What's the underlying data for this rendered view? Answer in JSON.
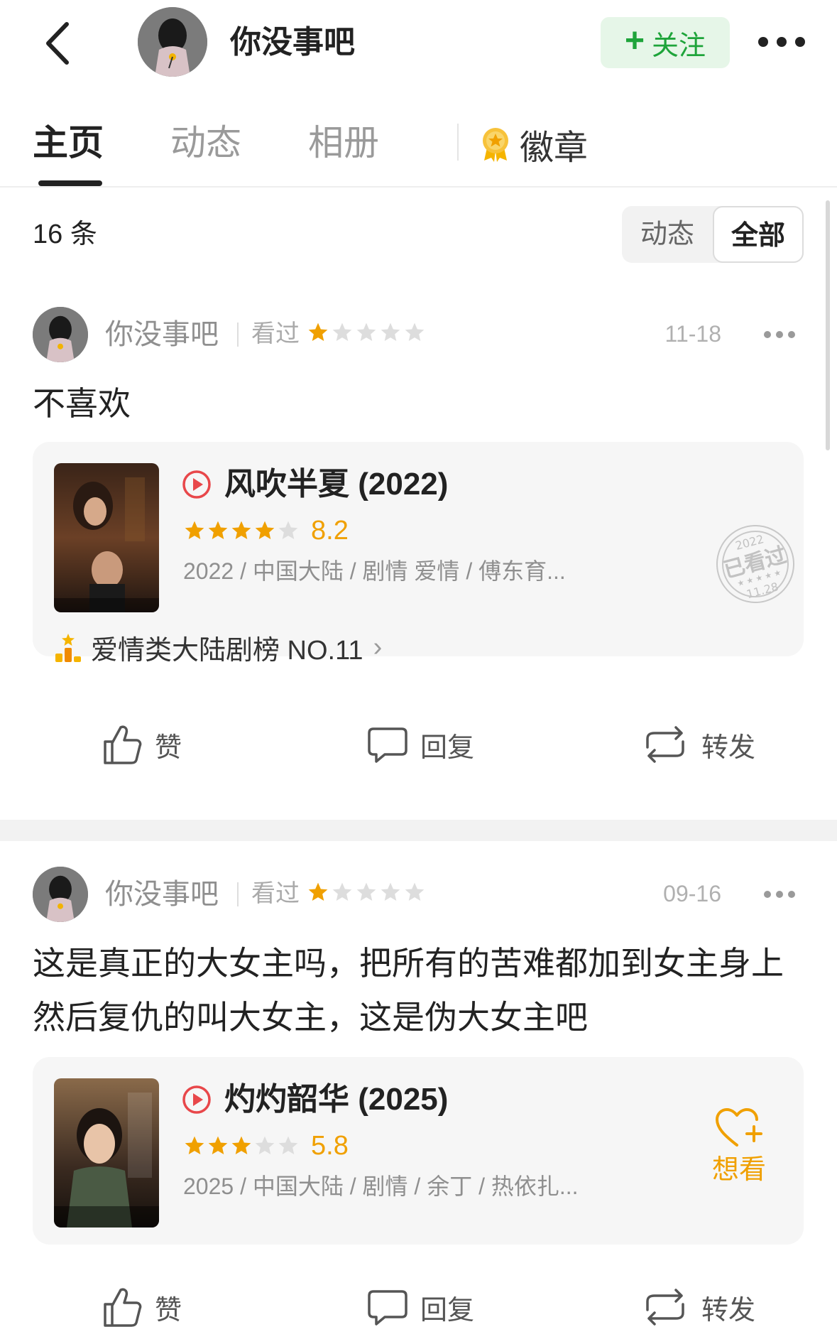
{
  "header": {
    "name": "你没事吧",
    "follow_label": "关注"
  },
  "tabs": [
    {
      "label": "主页",
      "active": true
    },
    {
      "label": "动态",
      "active": false
    },
    {
      "label": "相册",
      "active": false
    },
    {
      "label": "徽章",
      "active": false,
      "icon": "medal-icon"
    }
  ],
  "filter": {
    "count": "16 条",
    "options": [
      "动态",
      "全部"
    ],
    "selected": "全部"
  },
  "posts": [
    {
      "user": "你没事吧",
      "status": "看过",
      "user_rating": 1,
      "date": "11-18",
      "text": "不喜欢",
      "movie": {
        "title": "风吹半夏 (2022)",
        "rating_stars": 4,
        "rating": "8.2",
        "meta": "2022 / 中国大陆 / 剧情 爱情 / 傅东育...",
        "rank": "爱情类大陆剧榜 NO.11",
        "stamp": {
          "year": "2022",
          "label": "已看过",
          "date": "11.28"
        }
      }
    },
    {
      "user": "你没事吧",
      "status": "看过",
      "user_rating": 1,
      "date": "09-16",
      "text": "这是真正的大女主吗，把所有的苦难都加到女主身上然后复仇的叫大女主，这是伪大女主吧",
      "movie": {
        "title": "灼灼韶华 (2025)",
        "rating_stars": 3,
        "rating": "5.8",
        "meta": "2025 / 中国大陆 / 剧情 / 余丁 / 热依扎...",
        "want_label": "想看"
      }
    }
  ],
  "actions": {
    "like": "赞",
    "reply": "回复",
    "share": "转发"
  },
  "colors": {
    "accent_green": "#1ea43a",
    "follow_bg": "#e6f6e8",
    "star": "#f0a000",
    "play_red": "#e8474a"
  }
}
